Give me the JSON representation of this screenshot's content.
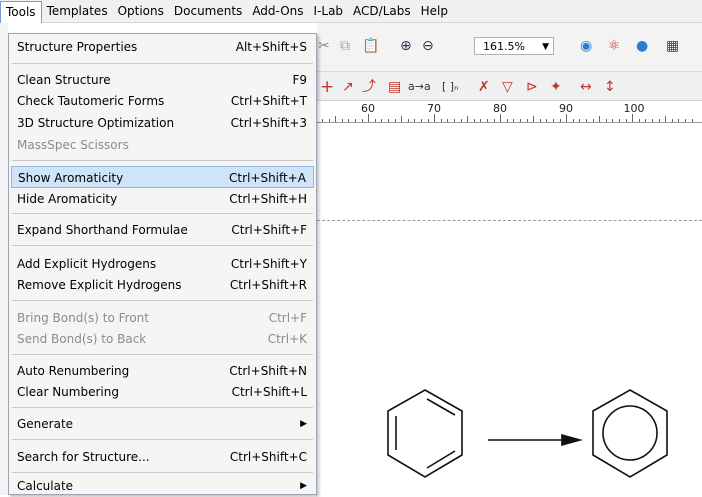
{
  "menubar": [
    "Tools",
    "Templates",
    "Options",
    "Documents",
    "Add-Ons",
    "I-Lab",
    "ACD/Labs",
    "Help"
  ],
  "toolbar": {
    "zoom": "161.5%"
  },
  "ruler": {
    "labels": [
      "60",
      "70",
      "80",
      "90",
      "100"
    ]
  },
  "menu": {
    "structure_properties": {
      "label": "Structure Properties",
      "shortcut": "Alt+Shift+S"
    },
    "clean_structure": {
      "label": "Clean Structure",
      "shortcut": "F9"
    },
    "check_tautomeric": {
      "label": "Check Tautomeric Forms",
      "shortcut": "Ctrl+Shift+T"
    },
    "opt_3d": {
      "label": "3D Structure Optimization",
      "shortcut": "Ctrl+Shift+3"
    },
    "massspec": {
      "label": "MassSpec Scissors",
      "shortcut": ""
    },
    "show_aromaticity": {
      "label": "Show Aromaticity",
      "shortcut": "Ctrl+Shift+A"
    },
    "hide_aromaticity": {
      "label": "Hide Aromaticity",
      "shortcut": "Ctrl+Shift+H"
    },
    "expand_shorthand": {
      "label": "Expand Shorthand Formulae",
      "shortcut": "Ctrl+Shift+F"
    },
    "add_hydrogens": {
      "label": "Add Explicit Hydrogens",
      "shortcut": "Ctrl+Shift+Y"
    },
    "remove_hydrogens": {
      "label": "Remove Explicit Hydrogens",
      "shortcut": "Ctrl+Shift+R"
    },
    "bring_front": {
      "label": "Bring Bond(s) to Front",
      "shortcut": "Ctrl+F"
    },
    "send_back": {
      "label": "Send Bond(s) to Back",
      "shortcut": "Ctrl+K"
    },
    "auto_renumber": {
      "label": "Auto Renumbering",
      "shortcut": "Ctrl+Shift+N"
    },
    "clear_numbering": {
      "label": "Clear Numbering",
      "shortcut": "Ctrl+Shift+L"
    },
    "generate": {
      "label": "Generate"
    },
    "search_structure": {
      "label": "Search for Structure...",
      "shortcut": "Ctrl+Shift+C"
    },
    "calculate": {
      "label": "Calculate"
    }
  }
}
